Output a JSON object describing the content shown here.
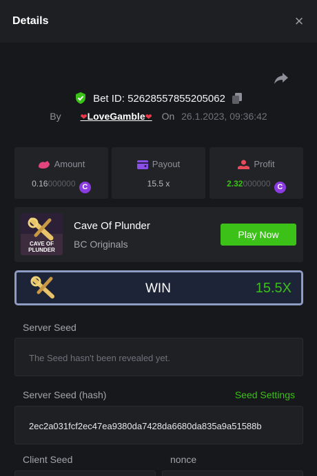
{
  "header": {
    "title": "Details",
    "close_label": "×"
  },
  "bet": {
    "id_label": "Bet ID:",
    "id": "52628557855205062"
  },
  "byline": {
    "by_label": "By",
    "username": "LoveGamble",
    "on_label": "On",
    "datetime": "26.1.2023, 09:36:42"
  },
  "stats": {
    "amount": {
      "label": "Amount",
      "value_main": "0.16",
      "value_dim": "000000",
      "currency": "C"
    },
    "payout": {
      "label": "Payout",
      "value": "15.5 x"
    },
    "profit": {
      "label": "Profit",
      "value_main": "2.32",
      "value_dim": "000000",
      "currency": "C"
    }
  },
  "game": {
    "name": "Cave Of Plunder",
    "provider": "BC Originals",
    "play_label": "Play Now",
    "thumb_text": "CAVE OF PLUNDER"
  },
  "result": {
    "label": "WIN",
    "multiplier": "15.5X"
  },
  "server_seed": {
    "label": "Server Seed",
    "value": "The Seed hasn't been revealed yet."
  },
  "server_seed_hash": {
    "label": "Server Seed (hash)",
    "settings_link": "Seed Settings",
    "value": "2ec2a031fcf2ec47ea9380da7428da6680da835a9a51588b"
  },
  "client_seed": {
    "label": "Client Seed"
  },
  "nonce": {
    "label": "nonce"
  },
  "colors": {
    "accent_green": "#3bc117",
    "background": "#17181b",
    "panel": "#222327",
    "coin_purple": "#8b3ce0",
    "heart_red": "#e8394a"
  }
}
